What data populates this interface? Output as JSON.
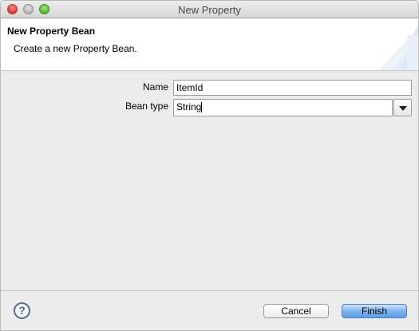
{
  "window": {
    "title": "New Property"
  },
  "banner": {
    "title": "New Property Bean",
    "description": "Create a new Property Bean."
  },
  "form": {
    "name_label": "Name",
    "name_value": "ItemId",
    "bean_type_label": "Bean type",
    "bean_type_value": "String"
  },
  "buttons": {
    "help": "?",
    "cancel": "Cancel",
    "finish": "Finish"
  },
  "colors": {
    "accent_button": "#7fb3ee",
    "close_button": "#e0443a",
    "maximize_button": "#5fbf3a"
  }
}
